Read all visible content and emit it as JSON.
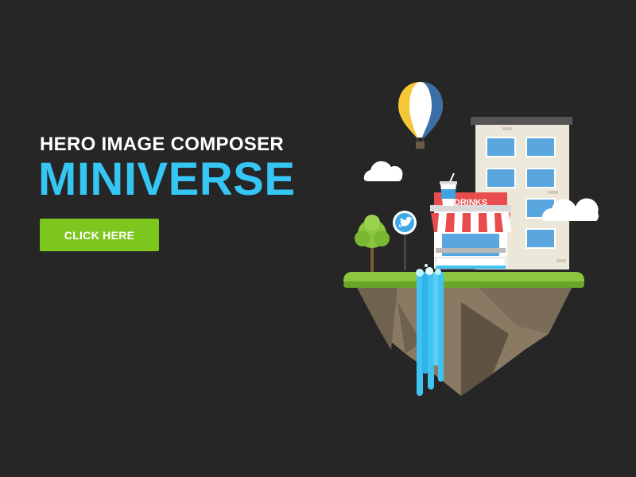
{
  "hero": {
    "subtitle": "HERO IMAGE COMPOSER",
    "title": "MINIVERSE",
    "cta_label": "CLICK HERE"
  },
  "shop": {
    "sign_text": "DRINKS"
  },
  "colors": {
    "background": "#262626",
    "title": "#35c6f4",
    "cta": "#7dc61e",
    "grass": "#8cc63f",
    "rock": "#8a7a63",
    "water": "#3fc3f0",
    "shop_red": "#e84c4c"
  },
  "icons": [
    "hot-air-balloon-icon",
    "cloud-icon",
    "tree-icon",
    "twitter-bird-icon",
    "drink-cup-icon"
  ]
}
